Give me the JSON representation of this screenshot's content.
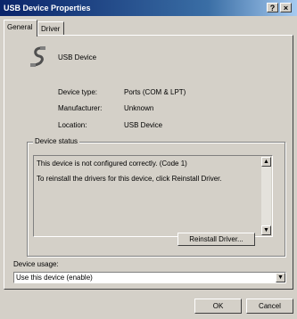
{
  "window": {
    "title": "USB Device Properties",
    "help_button": "?",
    "close_button": "×"
  },
  "tabs": [
    {
      "label": "General"
    },
    {
      "label": "Driver"
    }
  ],
  "device": {
    "icon": "usb-device-icon",
    "name": "USB Device"
  },
  "properties": [
    {
      "label": "Device type:",
      "value": "Ports (COM & LPT)"
    },
    {
      "label": "Manufacturer:",
      "value": "Unknown"
    },
    {
      "label": "Location:",
      "value": "USB Device"
    }
  ],
  "status": {
    "group_label": "Device status",
    "line1": "This device is not configured correctly. (Code 1)",
    "line2": "To reinstall the drivers for this device, click Reinstall Driver.",
    "reinstall_button": "Reinstall Driver..."
  },
  "usage": {
    "label": "Device usage:",
    "selected": "Use this device (enable)"
  },
  "footer": {
    "ok": "OK",
    "cancel": "Cancel"
  }
}
